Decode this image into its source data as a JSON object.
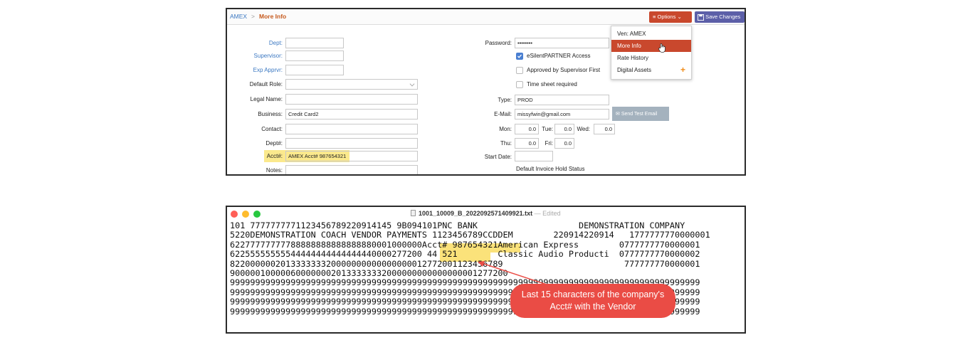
{
  "top": {
    "breadcrumb": {
      "root": "AMEX",
      "sep": ">",
      "current": "More Info"
    },
    "options_label": "Options",
    "save_label": "Save Changes",
    "left_fields": [
      {
        "label": "Dept:",
        "value": "",
        "link": true
      },
      {
        "label": "Supervisor:",
        "value": "",
        "link": true
      },
      {
        "label": "Exp Apprvr:",
        "value": "",
        "link": true
      },
      {
        "label": "Default Role:",
        "value": "",
        "link": false
      },
      {
        "label": "Legal Name:",
        "value": "",
        "link": false
      },
      {
        "label": "Business:",
        "value": "Credit Card2",
        "link": false
      },
      {
        "label": "Contact:",
        "value": "",
        "link": false
      },
      {
        "label": "Dept#:",
        "value": "",
        "link": false
      },
      {
        "label": "Acct#:",
        "value": "AMEX Acct# 987654321",
        "link": false
      },
      {
        "label": "Notes:",
        "value": "",
        "link": false
      }
    ],
    "password_label": "Password:",
    "password_value": "••••••••",
    "checkboxes": [
      {
        "label": "eSilentPARTNER Access",
        "checked": true
      },
      {
        "label": "Approved by Supervisor First",
        "checked": false
      },
      {
        "label": "Time sheet required",
        "checked": false
      }
    ],
    "type_label": "Type:",
    "type_value": "PROD",
    "email_label": "E-Mail:",
    "email_value": "missyfwin@gmail.com",
    "send_test_label": "Send Test Email",
    "days": [
      {
        "label": "Mon:",
        "value": "0.0"
      },
      {
        "label": "Tue:",
        "value": "0.0"
      },
      {
        "label": "Wed:",
        "value": "0.0"
      },
      {
        "label": "Thu:",
        "value": "0.0"
      },
      {
        "label": "Fri:",
        "value": "0.0"
      }
    ],
    "start_date_label": "Start Date:",
    "default_invoice_label": "Default Invoice Hold Status",
    "dropdown": [
      "Ven: AMEX",
      "More Info",
      "Rate History",
      "Digital Assets"
    ],
    "colors": {
      "options_red": "#c9482d",
      "save_purple": "#5c5fa8",
      "highlight": "#fbe98d"
    }
  },
  "bottom": {
    "file_name": "1001_10009_B_20220925714099 21.txt",
    "file_name_exact": "1001_10009_B_2022092571409921.txt",
    "edited": "— Edited",
    "lines": [
      "101 7777777771123456789220914145 9B094101PNC BANK                    DEMONSTRATION COMPANY",
      "5220DEMONSTRATION COACH VENDOR PAYMENTS 1123456789CCDDEM        220914220914   1777777770000001",
      "62277777777788888888888888880001000000Acct# 987654321American Express        0777777770000001",
      "62255555555544444444444444440000277200 44 521        Classic Audio Producti  0777777770000002",
      "822000000201333333320000000000000000012772001123456789                        777777770000001",
      "9000001000006000000020133333332000000000000000001277200",
      "999999999999999999999999999999999999999999999999999999999999999999999999999999999999999999999",
      "999999999999999999999999999999999999999999999999999999999999999999999999999999999999999999999",
      "999999999999999999999999999999999999999999999999999999999999999999999999999999999999999999999",
      "999999999999999999999999999999999999999999999999999999999999999999999999999999999999999999999"
    ],
    "callout": "Last 15 characters of the company's Acct# with the Vendor",
    "colors": {
      "close": "#ff5f57",
      "minimize": "#febc2e",
      "zoom": "#28c840",
      "callout": "#ea4c45",
      "highlight": "#fbe27a"
    }
  }
}
